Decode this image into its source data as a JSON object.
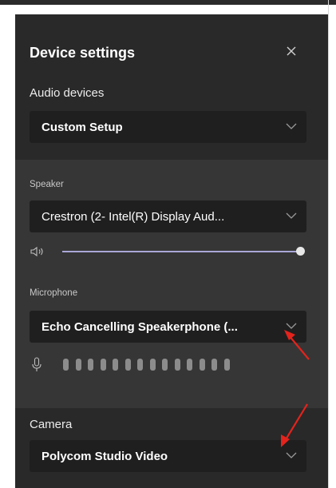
{
  "panel": {
    "title": "Device settings",
    "close_icon": "close-icon"
  },
  "audio": {
    "label": "Audio devices",
    "selected": "Custom Setup"
  },
  "speaker": {
    "label": "Speaker",
    "selected": "Crestron (2- Intel(R) Display Aud...",
    "volume_icon": "speaker-volume-icon",
    "volume_level": 1.0
  },
  "microphone": {
    "label": "Microphone",
    "selected": "Echo Cancelling Speakerphone (...",
    "mic_icon": "microphone-icon",
    "level_bars": 14
  },
  "camera": {
    "label": "Camera",
    "selected": "Polycom Studio Video"
  },
  "colors": {
    "panel_bg": "#292929",
    "section_bg": "#363636",
    "dropdown_bg": "#1f1f1f",
    "accent": "#a9a7d8",
    "annotation_arrow": "#e3231c"
  }
}
